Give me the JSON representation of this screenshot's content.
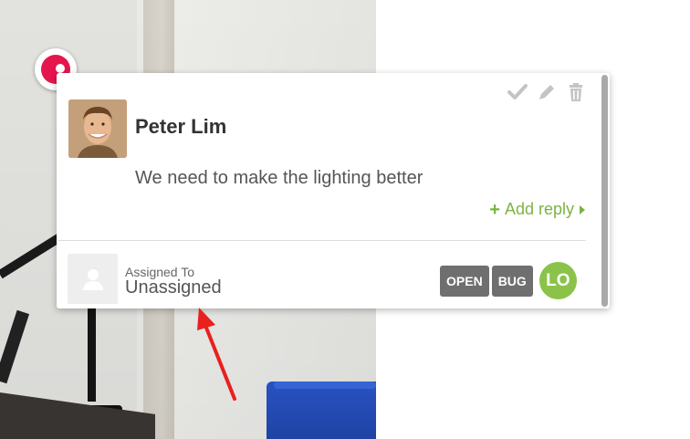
{
  "comment": {
    "author": "Peter Lim",
    "message": "We need to make the lighting better",
    "add_reply_label": "Add reply",
    "assigned_label": "Assigned To",
    "assigned_value": "Unassigned",
    "tags": [
      "OPEN",
      "BUG"
    ],
    "assignee_initials": "LO",
    "actions": [
      "check-icon",
      "pencil-icon",
      "trash-icon"
    ]
  },
  "colors": {
    "pin": "#e5154d",
    "accent_green": "#7cb342",
    "tag_bg": "#6f6f6f",
    "user_circle": "#8bc34a",
    "annotation_arrow": "#e8201f"
  }
}
